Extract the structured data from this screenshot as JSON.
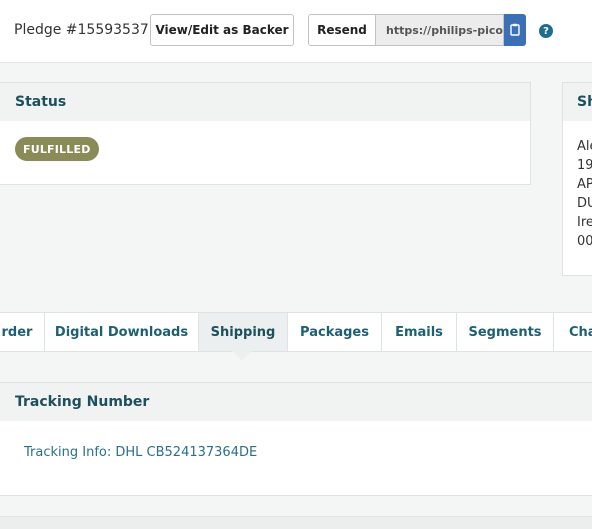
{
  "header": {
    "pledge_title": "Pledge #15593537",
    "view_edit_label": "View/Edit as Backer",
    "resend_label": "Resend",
    "url_value": "https://philips-picop",
    "copy_icon": "clipboard-icon",
    "help_icon": "question-icon",
    "help_glyph": "?"
  },
  "status": {
    "heading": "Status",
    "badge": "FULFILLED",
    "badge_color": "#8a8b56"
  },
  "shipping_panel": {
    "heading": "Sh",
    "address_lines": [
      "Ale",
      "19",
      "AP",
      "DU",
      "Ire",
      "00"
    ]
  },
  "tabs": [
    {
      "label": "rder"
    },
    {
      "label": "Digital Downloads"
    },
    {
      "label": "Shipping",
      "active": true
    },
    {
      "label": "Packages"
    },
    {
      "label": "Emails"
    },
    {
      "label": "Segments"
    },
    {
      "label": "Cha"
    }
  ],
  "tracking": {
    "heading": "Tracking Number",
    "link_text": "Tracking Info: DHL CB524137364DE"
  },
  "colors": {
    "accent_blue": "#3b6fb6",
    "heading_teal": "#1e4f5c",
    "link_teal": "#2a6f8a"
  }
}
